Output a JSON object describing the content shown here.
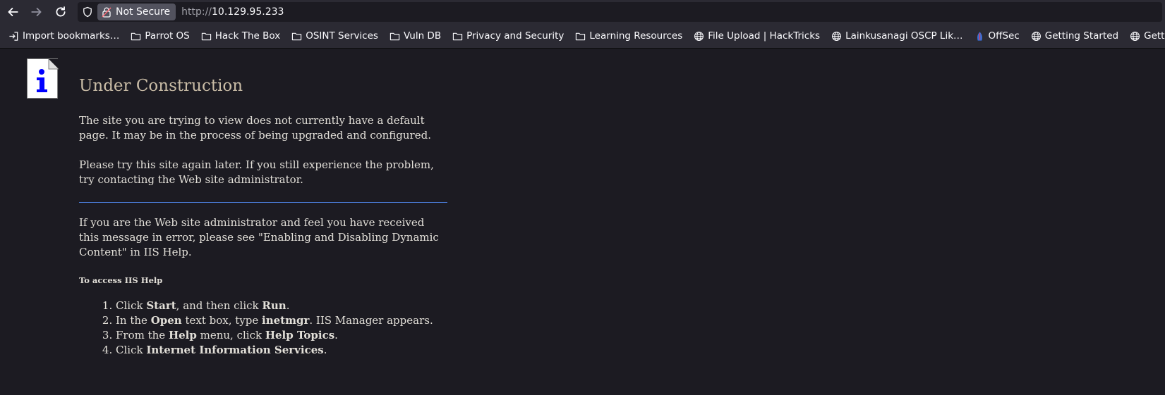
{
  "browser": {
    "security_label": "Not Secure",
    "url_scheme": "http://",
    "url_host": "10.129.95.233",
    "bookmarks": [
      {
        "label": "Import bookmarks…",
        "icon": "import-icon"
      },
      {
        "label": "Parrot OS",
        "icon": "folder-icon"
      },
      {
        "label": "Hack The Box",
        "icon": "folder-icon"
      },
      {
        "label": "OSINT Services",
        "icon": "folder-icon"
      },
      {
        "label": "Vuln DB",
        "icon": "folder-icon"
      },
      {
        "label": "Privacy and Security",
        "icon": "folder-icon"
      },
      {
        "label": "Learning Resources",
        "icon": "folder-icon"
      },
      {
        "label": "File Upload | HackTricks",
        "icon": "globe-icon"
      },
      {
        "label": "Lainkusanagi OSCP Lik…",
        "icon": "globe-icon"
      },
      {
        "label": "OffSec",
        "icon": "offsec-icon"
      },
      {
        "label": "Getting Started",
        "icon": "globe-icon"
      },
      {
        "label": "Getting Started",
        "icon": "globe-icon"
      }
    ]
  },
  "page": {
    "title": "Under Construction",
    "para1": "The site you are trying to view does not currently have a default page. It may be in the process of being upgraded and configured.",
    "para2": "Please try this site again later. If you still experience the problem, try contacting the Web site administrator.",
    "para3": "If you are the Web site administrator and feel you have received this message in error, please see \"Enabling and Disabling Dynamic Content\" in IIS Help.",
    "help_heading": "To access IIS Help",
    "steps": [
      [
        {
          "t": "Click "
        },
        {
          "t": "Start",
          "b": true
        },
        {
          "t": ", and then click "
        },
        {
          "t": "Run",
          "b": true
        },
        {
          "t": "."
        }
      ],
      [
        {
          "t": "In the "
        },
        {
          "t": "Open",
          "b": true
        },
        {
          "t": " text box, type "
        },
        {
          "t": "inetmgr",
          "b": true
        },
        {
          "t": ". IIS Manager appears."
        }
      ],
      [
        {
          "t": "From the "
        },
        {
          "t": "Help",
          "b": true
        },
        {
          "t": " menu, click "
        },
        {
          "t": "Help Topics",
          "b": true
        },
        {
          "t": "."
        }
      ],
      [
        {
          "t": "Click "
        },
        {
          "t": "Internet Information Services",
          "b": true
        },
        {
          "t": "."
        }
      ]
    ]
  },
  "colors": {
    "chrome": "#2b2a33",
    "page_bg": "#1c1b22",
    "rule": "#4a7bd6",
    "title": "#c9bca6",
    "info_icon_blue": "#0000ff"
  }
}
